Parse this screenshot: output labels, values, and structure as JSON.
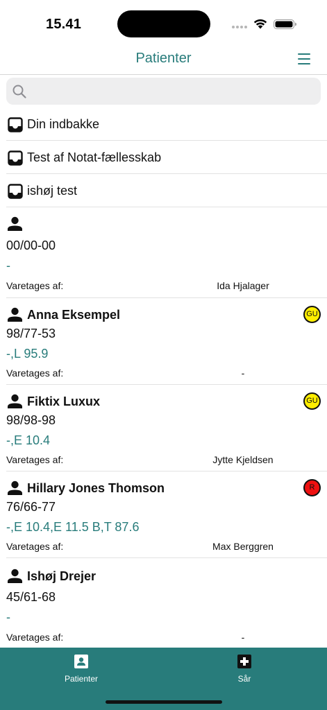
{
  "status_bar": {
    "time": "15.41",
    "icons": [
      "signal-icon",
      "wifi-icon",
      "battery-icon"
    ]
  },
  "nav": {
    "title": "Patienter",
    "menu_icon": "hamburger-menu-icon"
  },
  "search": {
    "placeholder": "",
    "value": "",
    "icon": "search-icon"
  },
  "inboxes": [
    {
      "label": "Din indbakke",
      "icon": "inbox-icon"
    },
    {
      "label": "Test af Notat-fællesskab",
      "icon": "inbox-icon"
    },
    {
      "label": "ishøj test",
      "icon": "inbox-icon"
    }
  ],
  "caretaker_label": "Varetages af:",
  "patients": [
    {
      "name": "",
      "cpr": "00/00-00",
      "wounds": "-",
      "caretaker": "Ida Hjalager",
      "badge": null
    },
    {
      "name": "Anna Eksempel",
      "cpr": "98/77-53",
      "wounds": "-,L 95.9",
      "caretaker": "-",
      "badge": {
        "text": "GU",
        "color": "#ffee00"
      }
    },
    {
      "name": "Fiktix Luxux",
      "cpr": "98/98-98",
      "wounds": "-,E 10.4",
      "caretaker": "Jytte Kjeldsen",
      "badge": {
        "text": "GU",
        "color": "#ffee00"
      }
    },
    {
      "name": "Hillary Jones Thomson",
      "cpr": "76/66-77",
      "wounds": "-,E 10.4,E 11.5 B,T 87.6",
      "caretaker": "Max Berggren",
      "badge": {
        "text": "R",
        "color": "#ee1111"
      }
    },
    {
      "name": "Ishøj Drejer",
      "cpr": "45/61-68",
      "wounds": "-",
      "caretaker": "-",
      "badge": null
    }
  ],
  "tabs": [
    {
      "label": "Patienter",
      "icon": "patient-card-icon"
    },
    {
      "label": "Sår",
      "icon": "medical-cross-icon"
    }
  ],
  "colors": {
    "accent": "#287c7b",
    "badge_yellow": "#ffee00",
    "badge_red": "#ee1111"
  }
}
